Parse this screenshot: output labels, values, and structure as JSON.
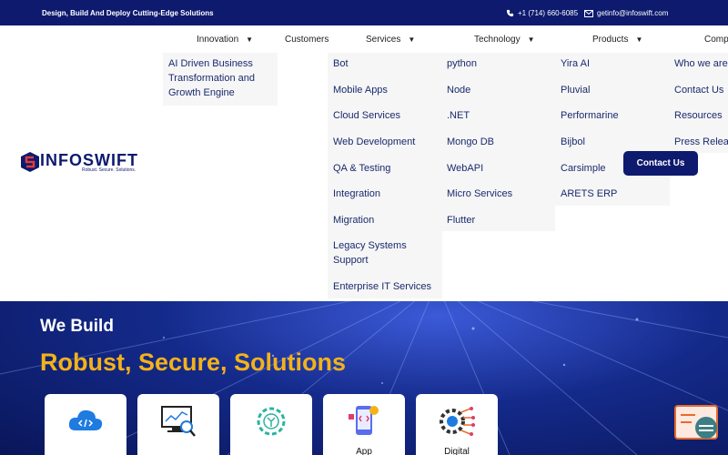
{
  "topbar": {
    "tagline": "Design, Build And Deploy Cutting-Edge Solutions",
    "phone": "+1 (714) 660-6085",
    "email": "getinfo@infoswift.com"
  },
  "nav": {
    "innovation": "Innovation",
    "customers": "Customers",
    "services": "Services",
    "technology": "Technology",
    "products": "Products",
    "company": "Comp"
  },
  "logo": {
    "word": "INFOSWIFT",
    "tagline": "Robust. Secure. Solutions."
  },
  "innovation_menu": [
    "AI Driven Business",
    "Transformation and",
    "Growth Engine"
  ],
  "services_menu": [
    "Bot",
    "Mobile Apps",
    "Cloud Services",
    "Web Development",
    "QA & Testing",
    "Integration",
    "Migration",
    "Legacy Systems",
    "Support",
    "Enterprise IT Services"
  ],
  "technology_menu": [
    "python",
    "Node",
    ".NET",
    "Mongo DB",
    "WebAPI",
    "Micro Services",
    "Flutter"
  ],
  "products_menu": [
    "Yira AI",
    "Pluvial",
    "Performarine",
    "Bijbol",
    "Carsimple",
    "ARETS ERP"
  ],
  "company_menu": [
    "Who we are",
    "Contact Us",
    "Resources",
    "Press Relea"
  ],
  "contact_button": "Contact Us",
  "hero": {
    "line1": "We Build",
    "line2": "Robust, Secure, Solutions",
    "cards": [
      "",
      "",
      "",
      "App",
      "Digital"
    ]
  },
  "colors": {
    "navy": "#0d1a6e",
    "gold": "#f3b21a"
  }
}
